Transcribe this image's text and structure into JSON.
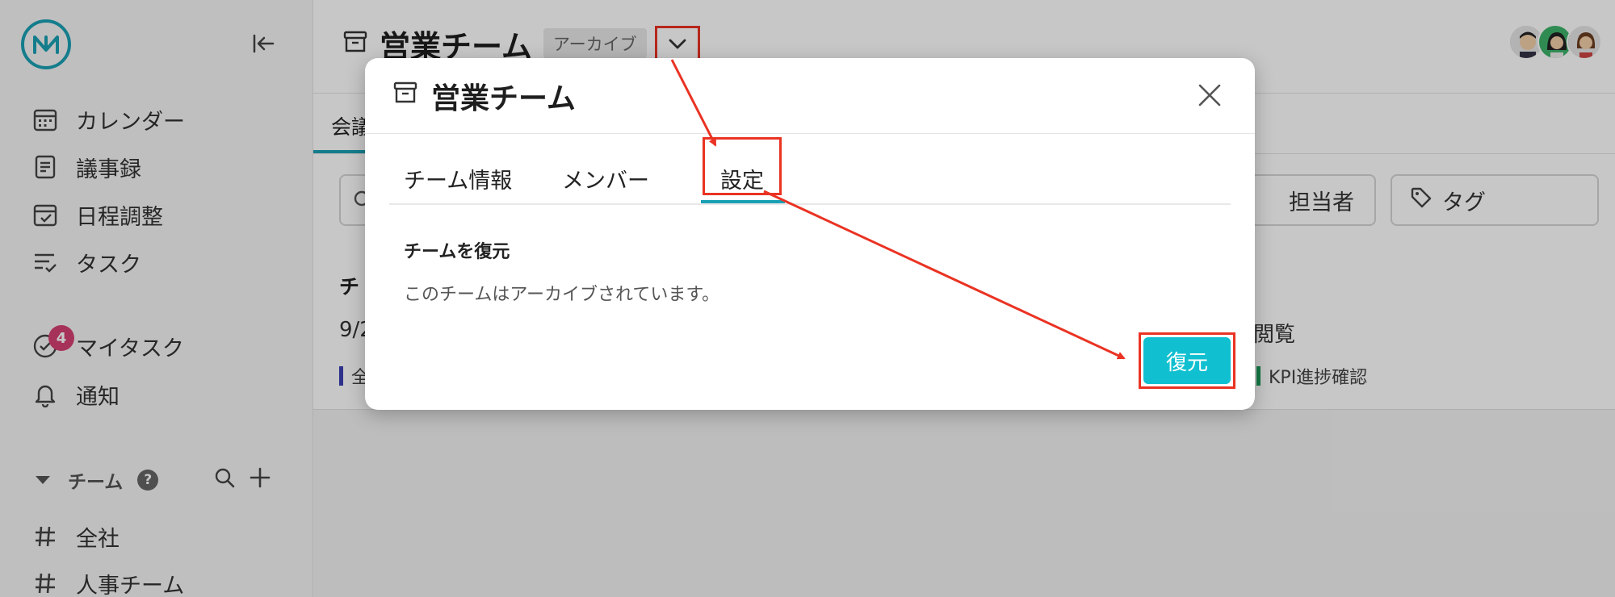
{
  "sidebar": {
    "nav": [
      {
        "label": "カレンダー",
        "icon": "calendar-icon"
      },
      {
        "label": "議事録",
        "icon": "minutes-icon"
      },
      {
        "label": "日程調整",
        "icon": "schedule-icon"
      },
      {
        "label": "タスク",
        "icon": "task-icon"
      }
    ],
    "my_task": {
      "label": "マイタスク",
      "badge": "4"
    },
    "notifications": {
      "label": "通知"
    },
    "teams_section": {
      "label": "チーム",
      "help": "?"
    },
    "teams": [
      {
        "label": "全社",
        "icon": "hash-icon"
      },
      {
        "label": "人事チーム",
        "icon": "hash-icon"
      }
    ]
  },
  "header": {
    "title": "営業チーム",
    "archive_badge": "アーカイブ"
  },
  "main": {
    "active_tab": "会議",
    "filters": {
      "person_label": "担当者",
      "tag_label": "タグ"
    },
    "list_item": {
      "title": "チ",
      "date": "9/2",
      "right_text": "閲覧",
      "tag_left": "全",
      "tag_right": "KPI進捗確認"
    }
  },
  "modal": {
    "title": "営業チーム",
    "tabs": [
      "チーム情報",
      "メンバー",
      "設定"
    ],
    "active_tab": "設定",
    "section_title": "チームを復元",
    "section_description": "このチームはアーカイブされています。",
    "restore_button": "復元"
  },
  "colors": {
    "accent": "#1aa0b4",
    "restore_button": "#10c0d0",
    "highlight_red": "#ea3323",
    "badge": "#d64073"
  }
}
